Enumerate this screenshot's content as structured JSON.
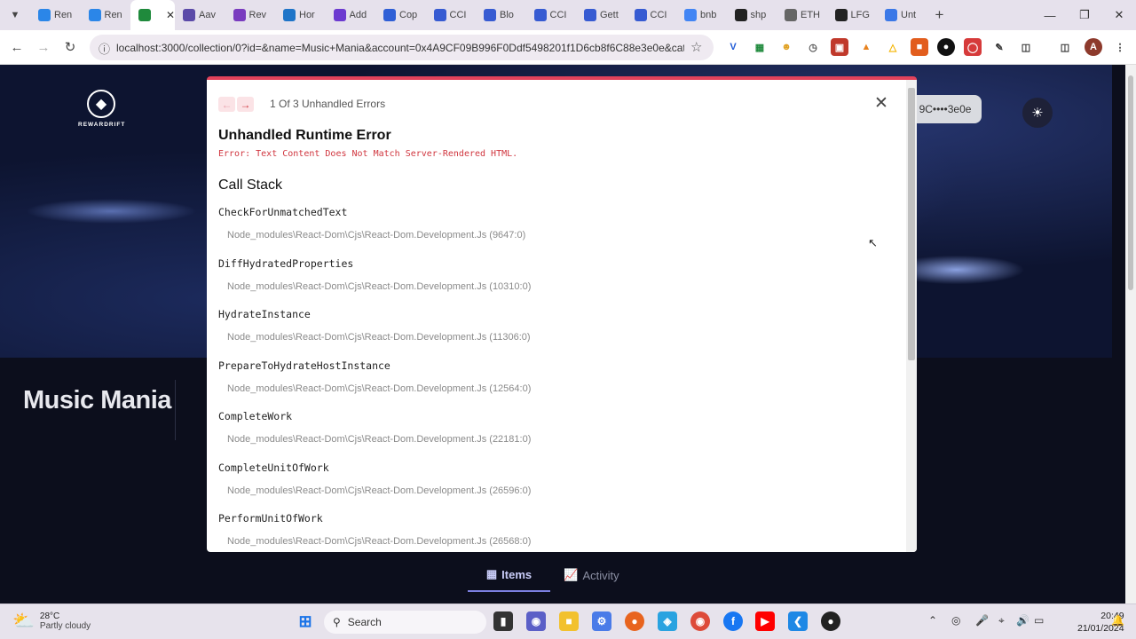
{
  "browser": {
    "tabs": [
      {
        "label": "",
        "favicon": "chevron-icon",
        "color": "#1b6fd6"
      },
      {
        "label": "Ren",
        "favicon": "blue-app-icon",
        "color": "#2b86e8"
      },
      {
        "label": "Ren",
        "favicon": "blue-app-icon",
        "color": "#2b86e8"
      },
      {
        "label": "",
        "favicon": "green-terminal-icon",
        "color": "#1f8a3c",
        "active": true
      },
      {
        "label": "Aav",
        "favicon": "aave-icon",
        "color": "#5b4aa8"
      },
      {
        "label": "Rev",
        "favicon": "purple-app-icon",
        "color": "#7a3cbf"
      },
      {
        "label": "Hor",
        "favicon": "blue-circle-icon",
        "color": "#1f74c8"
      },
      {
        "label": "Add",
        "favicon": "purple-box-icon",
        "color": "#6c3ad0"
      },
      {
        "label": "Cop",
        "favicon": "blue-square-icon",
        "color": "#2f5fd6"
      },
      {
        "label": "CCI",
        "favicon": "chainlink-icon",
        "color": "#375bd2"
      },
      {
        "label": "Blo",
        "favicon": "chainlink-icon",
        "color": "#375bd2"
      },
      {
        "label": "CCI",
        "favicon": "chainlink-icon",
        "color": "#375bd2"
      },
      {
        "label": "Gett",
        "favicon": "chainlink-icon",
        "color": "#375bd2"
      },
      {
        "label": "CCI",
        "favicon": "chainlink-icon",
        "color": "#375bd2"
      },
      {
        "label": "bnb",
        "favicon": "google-icon",
        "color": "#4285f4"
      },
      {
        "label": "shp",
        "favicon": "github-icon",
        "color": "#222222"
      },
      {
        "label": "ETH",
        "favicon": "eth-icon",
        "color": "#666666"
      },
      {
        "label": "LFG",
        "favicon": "notion-icon",
        "color": "#222222"
      },
      {
        "label": "Unt",
        "favicon": "docs-icon",
        "color": "#3b78e7"
      }
    ],
    "url": "localhost:3000/collection/0?id=&name=Music+Mania&account=0x4A9CF09B996F0Ddf5498201f1D6cb8f6C88e3e0e&cate..."
  },
  "page": {
    "logo_text": "REWARDRIFT",
    "account_short": "9C••••3e0e",
    "collection_name": "Music Mania",
    "tabs": [
      {
        "label": "Items",
        "active": true
      },
      {
        "label": "Activity",
        "active": false
      }
    ]
  },
  "error_overlay": {
    "count_text": "1 Of 3 Unhandled Errors",
    "title": "Unhandled Runtime Error",
    "message": "Error: Text Content Does Not Match Server-Rendered HTML.",
    "call_stack_title": "Call Stack",
    "accent_color": "#e2425b",
    "frames": [
      {
        "fn": "CheckForUnmatchedText",
        "loc": "Node_modules\\React-Dom\\Cjs\\React-Dom.Development.Js (9647:0)"
      },
      {
        "fn": "DiffHydratedProperties",
        "loc": "Node_modules\\React-Dom\\Cjs\\React-Dom.Development.Js (10310:0)"
      },
      {
        "fn": "HydrateInstance",
        "loc": "Node_modules\\React-Dom\\Cjs\\React-Dom.Development.Js (11306:0)"
      },
      {
        "fn": "PrepareToHydrateHostInstance",
        "loc": "Node_modules\\React-Dom\\Cjs\\React-Dom.Development.Js (12564:0)"
      },
      {
        "fn": "CompleteWork",
        "loc": "Node_modules\\React-Dom\\Cjs\\React-Dom.Development.Js (22181:0)"
      },
      {
        "fn": "CompleteUnitOfWork",
        "loc": "Node_modules\\React-Dom\\Cjs\\React-Dom.Development.Js (26596:0)"
      },
      {
        "fn": "PerformUnitOfWork",
        "loc": "Node_modules\\React-Dom\\Cjs\\React-Dom.Development.Js (26568:0)"
      }
    ]
  },
  "taskbar": {
    "temperature": "28°C",
    "weather": "Partly cloudy",
    "search_placeholder": "Search",
    "time": "20:49",
    "date": "21/01/2024"
  }
}
